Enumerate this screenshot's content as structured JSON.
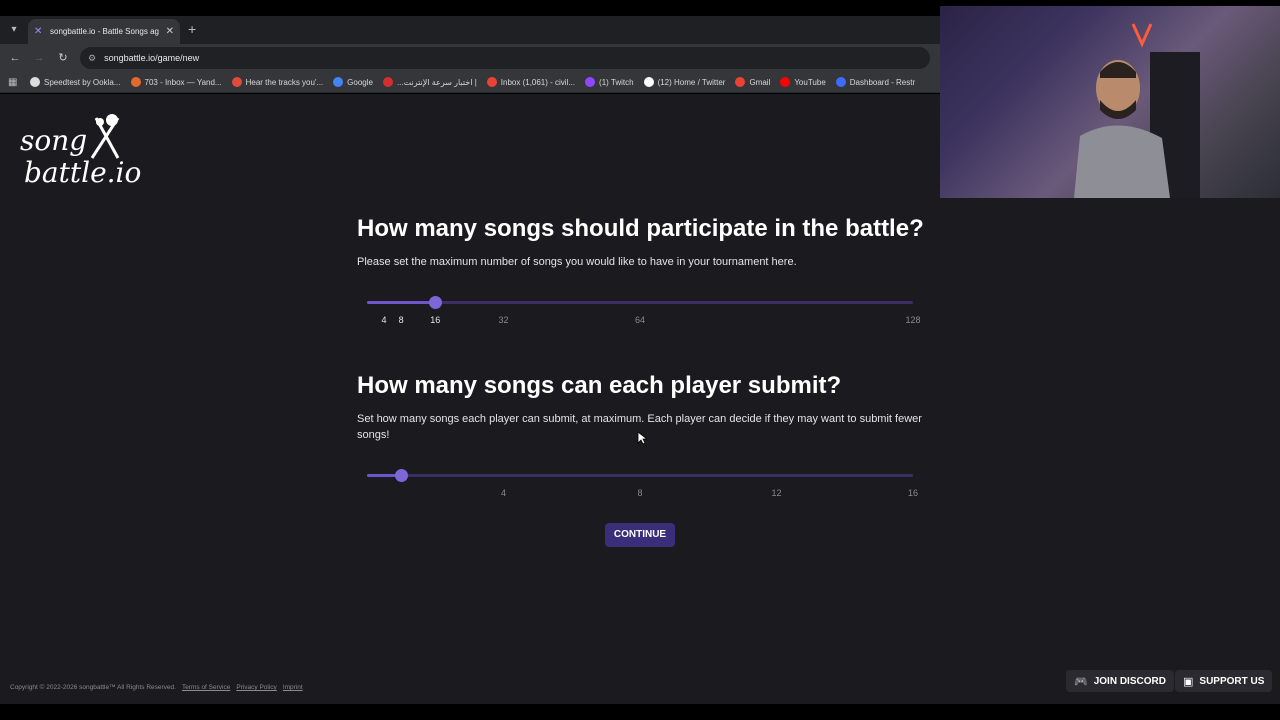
{
  "browser": {
    "tab": {
      "title": "songbattle.io - Battle Songs ag"
    },
    "url": "songbattle.io/game/new",
    "bookmarks": [
      {
        "label": "Speedtest by Ookla...",
        "icon": "speedtest-icon",
        "color": "#dddddd"
      },
      {
        "label": "703 - Inbox — Yand...",
        "icon": "yandex-mail-icon",
        "color": "#e26a2c"
      },
      {
        "label": "Hear the tracks you'...",
        "icon": "music-icon",
        "color": "#e04b3a"
      },
      {
        "label": "Google",
        "icon": "google-icon",
        "color": "#4285f4"
      },
      {
        "label": "...اختبار سرعة الإنترنت |",
        "icon": "speed-icon",
        "color": "#d32f2f"
      },
      {
        "label": "Inbox (1,061) - civil...",
        "icon": "gmail-icon",
        "color": "#ea4335"
      },
      {
        "label": "(1) Twitch",
        "icon": "twitch-icon",
        "color": "#9146ff"
      },
      {
        "label": "(12) Home / Twitter",
        "icon": "x-icon",
        "color": "#ffffff"
      },
      {
        "label": "Gmail",
        "icon": "gmail-icon",
        "color": "#ea4335"
      },
      {
        "label": "YouTube",
        "icon": "youtube-icon",
        "color": "#ff0000"
      },
      {
        "label": "Dashboard - Restr",
        "icon": "restream-icon",
        "color": "#3d6bff"
      }
    ]
  },
  "logo": {
    "line1": "song",
    "line2": "battle.io"
  },
  "section1": {
    "title": "How many songs should participate in the battle?",
    "description": "Please set the maximum number of songs you would like to have in your tournament here.",
    "slider": {
      "min": 0,
      "max": 128,
      "value": 16,
      "marks": [
        {
          "value": 4,
          "label": "4",
          "active": true
        },
        {
          "value": 8,
          "label": "8",
          "active": true
        },
        {
          "value": 16,
          "label": "16",
          "active": true
        },
        {
          "value": 32,
          "label": "32",
          "active": false
        },
        {
          "value": 64,
          "label": "64",
          "active": false
        },
        {
          "value": 128,
          "label": "128",
          "active": false
        }
      ]
    }
  },
  "section2": {
    "title": "How many songs can each player submit?",
    "description": "Set how many songs each player can submit, at maximum. Each player can decide if they may want to submit fewer songs!",
    "slider": {
      "min": 0,
      "max": 16,
      "value": 1,
      "marks": [
        {
          "value": 4,
          "label": "4",
          "active": false
        },
        {
          "value": 8,
          "label": "8",
          "active": false
        },
        {
          "value": 12,
          "label": "12",
          "active": false
        },
        {
          "value": 16,
          "label": "16",
          "active": false
        }
      ]
    }
  },
  "continue_label": "CONTINUE",
  "footer": {
    "copyright": "Copyright © 2022-2026 songbattle™ All Rights Reserved.",
    "links": [
      "Terms of Service",
      "Privacy Policy",
      "Imprint"
    ]
  },
  "buttons": {
    "discord": "JOIN DISCORD",
    "support": "SUPPORT US"
  },
  "colors": {
    "accent": "#7d66d8",
    "page_bg": "#1b1a1e",
    "button_bg": "#3a2d7a"
  }
}
